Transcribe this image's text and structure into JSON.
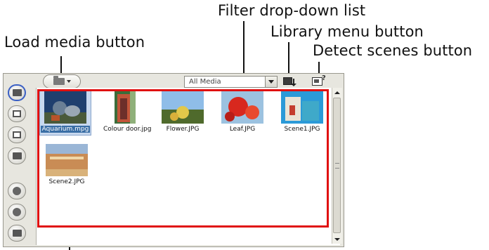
{
  "callouts": {
    "filter": "Filter drop-down list",
    "library_menu": "Library menu button",
    "load_media": "Load media button",
    "detect_scenes": "Detect scenes button"
  },
  "toolbar": {
    "filter_value": "All Media"
  },
  "media": [
    {
      "filename": "Aquarium.mpg",
      "selected": true
    },
    {
      "filename": "Colour door.jpg",
      "selected": false
    },
    {
      "filename": "Flower.JPG",
      "selected": false
    },
    {
      "filename": "Leaf.JPG",
      "selected": false
    },
    {
      "filename": "Scene1.JPG",
      "selected": false
    },
    {
      "filename": "Scene2.JPG",
      "selected": false
    }
  ],
  "colors": {
    "highlight": "#e01010",
    "selection": "#3a6ea5",
    "panel": "#e7e6df"
  }
}
